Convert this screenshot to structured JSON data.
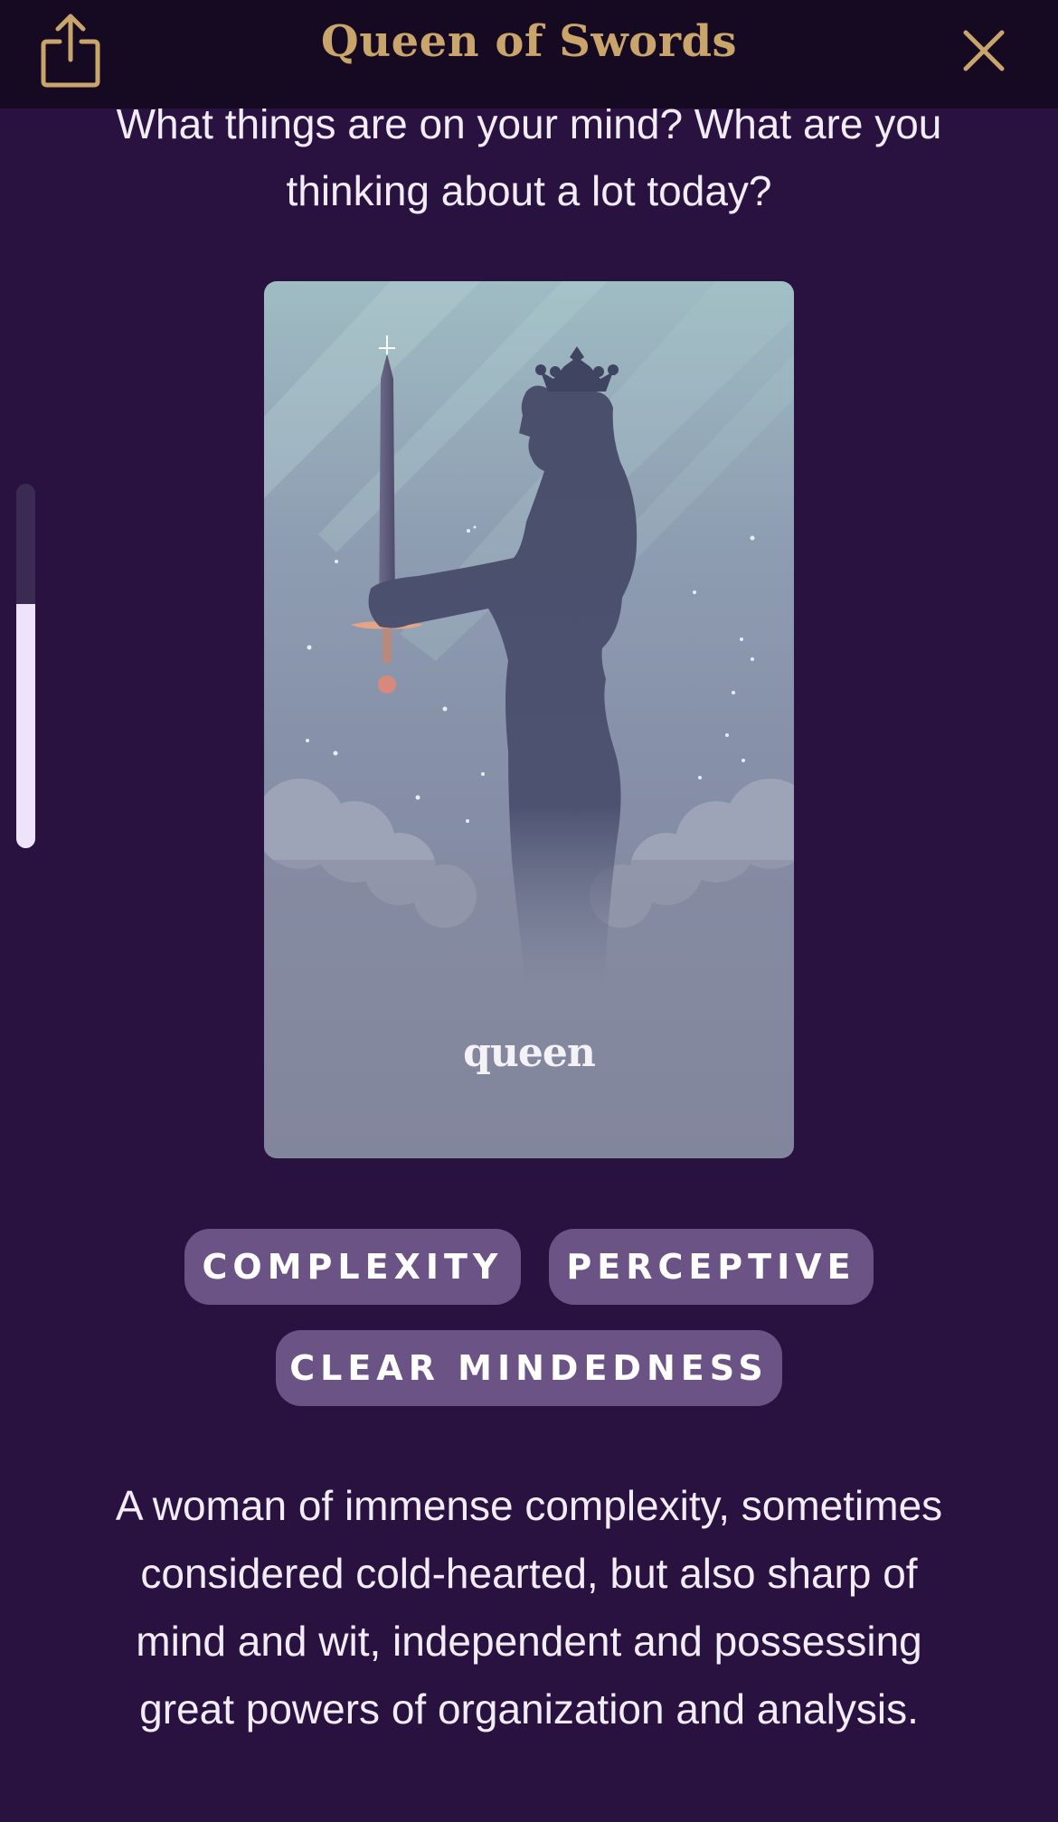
{
  "header": {
    "title": "Queen of Swords",
    "share_icon": "share-icon",
    "close_icon": "close-icon",
    "accent_color": "#c9a46b"
  },
  "prompt": {
    "question": "What things are on your mind? What are you thinking about a lot today?"
  },
  "scroll_indicator": {
    "progress": 0.67
  },
  "card": {
    "name": "queen",
    "image_subject": "silhouette of a crowned queen holding a sword among clouds"
  },
  "tags": [
    "COMPLEXITY",
    "PERCEPTIVE",
    "CLEAR MINDEDNESS"
  ],
  "description": "A woman of immense complexity, sometimes considered cold-hearted, but also sharp of mind and wit, independent and possessing great powers of organization and analysis.",
  "colors": {
    "background": "#2a1240",
    "header_background": "#150a22",
    "tag_background": "#6b5385",
    "text": "#f2ecf7"
  }
}
